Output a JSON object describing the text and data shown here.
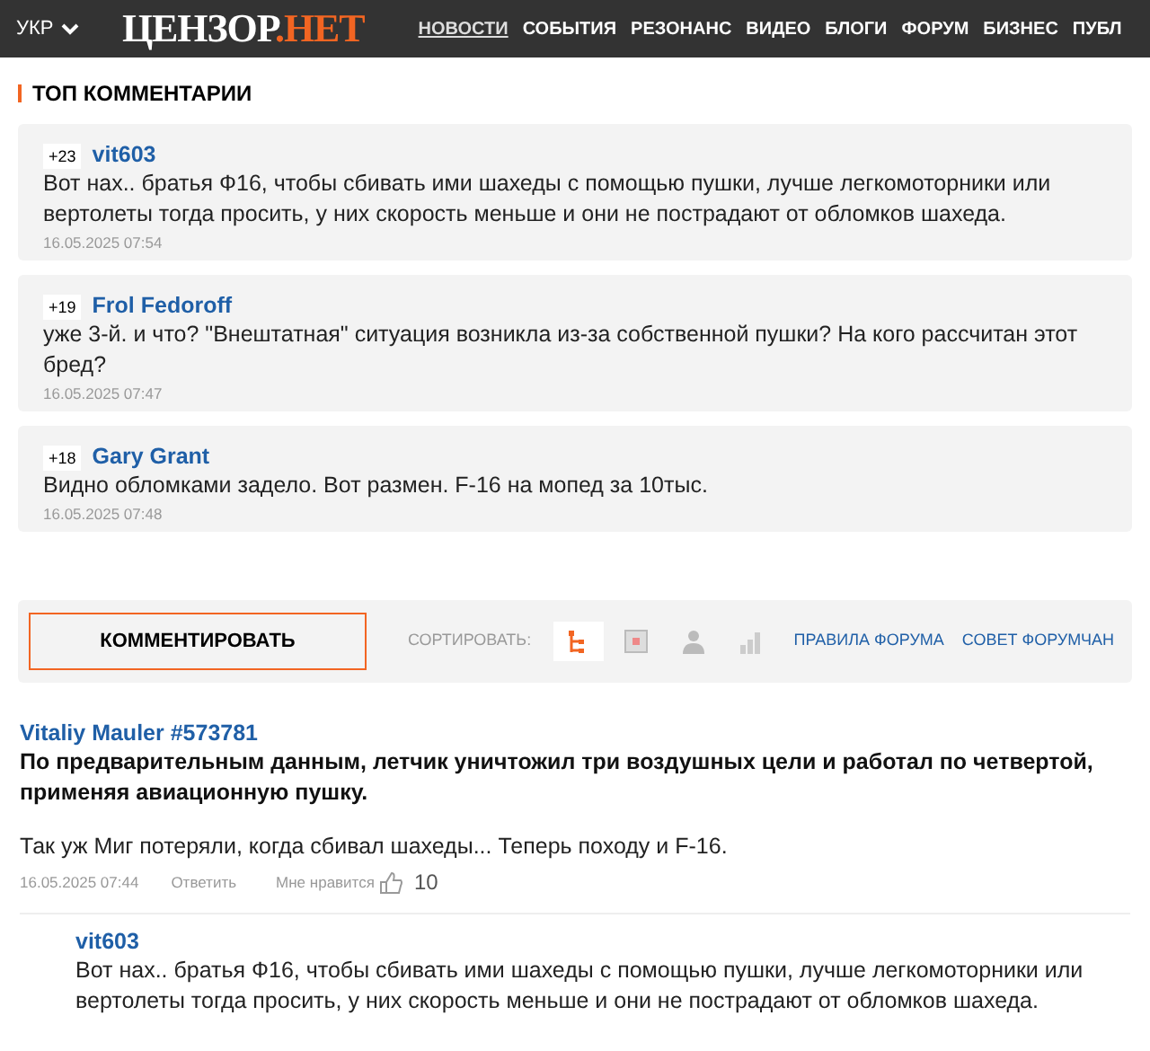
{
  "header": {
    "language": "УКР",
    "logo": {
      "main": "ЦЕНЗОР",
      "accent": ".НЕТ"
    },
    "nav": [
      {
        "label": "НОВОСТИ",
        "selected": true
      },
      {
        "label": "СОБЫТИЯ",
        "selected": false
      },
      {
        "label": "РЕЗОНАНС",
        "selected": false
      },
      {
        "label": "ВИДЕО",
        "selected": false
      },
      {
        "label": "БЛОГИ",
        "selected": false
      },
      {
        "label": "ФОРУМ",
        "selected": false
      },
      {
        "label": "БИЗНЕС",
        "selected": false
      },
      {
        "label": "ПУБЛ",
        "selected": false
      }
    ]
  },
  "top_comments": {
    "title": "ТОП КОММЕНТАРИИ",
    "items": [
      {
        "score": "+23",
        "author": "vit603",
        "text": "Вот нах.. братья Ф16, чтобы сбивать ими шахеды с помощью пушки, лучше легкомоторники или вертолеты тогда просить, у них скорость меньше и они не пострадают от обломков шахеда.",
        "date": "16.05.2025 07:54"
      },
      {
        "score": "+19",
        "author": "Frol Fedoroff",
        "text": "уже 3-й. и что? \"Внештатная\" ситуация возникла из-за собственной пушки? На кого рассчитан этот бред?",
        "date": "16.05.2025 07:47"
      },
      {
        "score": "+18",
        "author": "Gary Grant",
        "text": "Видно обломками задело. Вот размен. F-16 на мопед за 10тыс.",
        "date": "16.05.2025 07:48"
      }
    ]
  },
  "toolbar": {
    "comment_button": "КОММЕНТИРОВАТЬ",
    "sort_label": "СОРТИРОВАТЬ:",
    "sort_options": [
      {
        "kind": "tree",
        "selected": true
      },
      {
        "kind": "date",
        "selected": false
      },
      {
        "kind": "user",
        "selected": false
      },
      {
        "kind": "rating",
        "selected": false
      }
    ],
    "links": [
      "ПРАВИЛА ФОРУМА",
      "СОВЕТ ФОРУМЧАН"
    ]
  },
  "comments": [
    {
      "author": "Vitaliy Mauler #573781",
      "quote": "По предварительным данным, летчик уничтожил три воздушных цели и работал по четвертой, применяя авиационную пушку.",
      "text": "Так уж Миг потеряли, когда сбивал шахеды... Теперь походу и F-16.",
      "date": "16.05.2025 07:44",
      "reply": "Ответить",
      "like_label": "Мне нравится",
      "likes": "10",
      "replies": [
        {
          "author": "vit603",
          "text": "Вот нах.. братья Ф16, чтобы сбивать ими шахеды с помощью пушки, лучше легкомоторники или вертолеты тогда просить, у них скорость меньше и они не пострадают от обломков шахеда."
        }
      ]
    }
  ]
}
